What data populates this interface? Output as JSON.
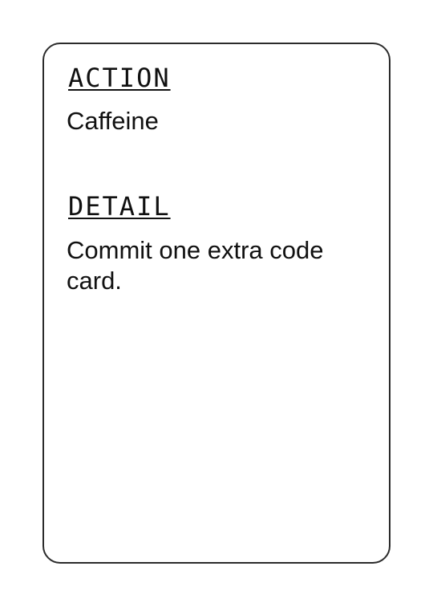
{
  "card": {
    "action_heading": "ACTION",
    "action_value": "Caffeine",
    "detail_heading": "DETAIL",
    "detail_value": "Commit one extra code card."
  },
  "colors": {
    "border": "#2b2b2b",
    "text": "#111111",
    "background": "#ffffff"
  }
}
